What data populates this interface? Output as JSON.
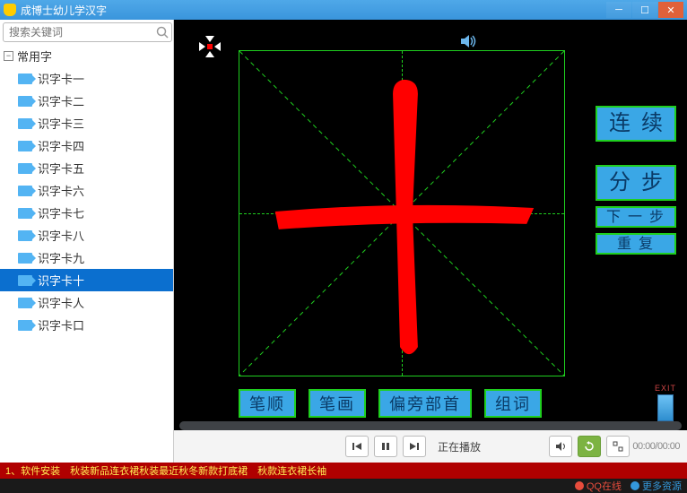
{
  "window": {
    "title": "成博士幼儿学汉字"
  },
  "sidebar": {
    "search_placeholder": "搜索关键词",
    "category": "常用字",
    "items": [
      "识字卡一",
      "识字卡二",
      "识字卡三",
      "识字卡四",
      "识字卡五",
      "识字卡六",
      "识字卡七",
      "识字卡八",
      "识字卡九",
      "识字卡十",
      "识字卡人",
      "识字卡口"
    ],
    "selected_index": 9
  },
  "character": {
    "glyph": "十",
    "color": "#ff0000"
  },
  "right_buttons": {
    "continuous": "连续",
    "step": "分步",
    "next": "下一步",
    "repeat": "重复"
  },
  "bottom_buttons": {
    "stroke_order": "笔顺",
    "strokes": "笔画",
    "radical": "偏旁部首",
    "words": "组词"
  },
  "exit": {
    "label": "EXIT"
  },
  "player": {
    "status": "正在播放",
    "time": "00:00/00:00"
  },
  "ticker": "1、软件安装　秋装新品连衣裙秋装最近秋冬新款打底裙　秋款连衣裙长袖",
  "status": {
    "qq": "QQ在线",
    "more": "更多资源"
  }
}
